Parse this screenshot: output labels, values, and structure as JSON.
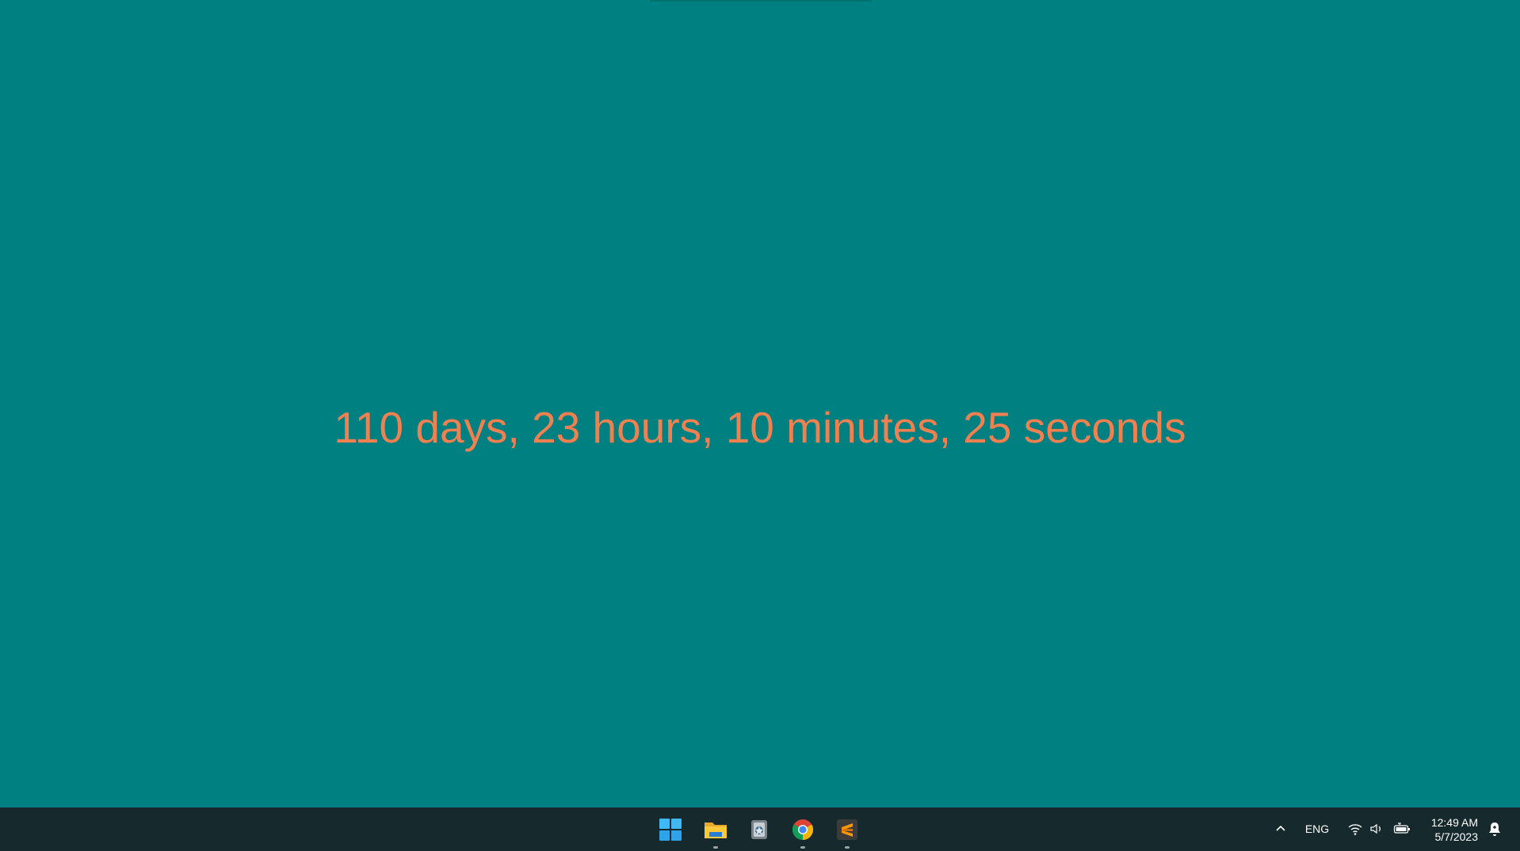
{
  "desktop": {
    "background_color": "#008080",
    "countdown_text": "110 days, 23 hours, 10 minutes, 25 seconds",
    "countdown_color": "#F08050"
  },
  "taskbar": {
    "background_color": "#16292D",
    "apps": [
      {
        "name": "start-button",
        "icon": "windows-logo-icon",
        "running": false
      },
      {
        "name": "file-explorer",
        "icon": "folder-icon",
        "running": true
      },
      {
        "name": "app-third",
        "icon": "notepad-app-icon",
        "running": false
      },
      {
        "name": "chrome",
        "icon": "chrome-icon",
        "running": true
      },
      {
        "name": "sublime-text",
        "icon": "sublime-text-icon",
        "running": true
      }
    ]
  },
  "tray": {
    "chevron_icon": "chevron-up-icon",
    "language": "ENG",
    "icons": [
      "wifi-icon",
      "speaker-icon",
      "battery-icon"
    ],
    "time": "12:49 AM",
    "date": "5/7/2023",
    "notification_icon": "notification-bell-icon"
  }
}
